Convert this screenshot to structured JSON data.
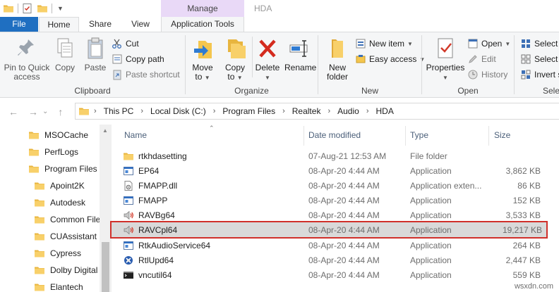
{
  "titlebar": {
    "context_tab": "Manage",
    "window_title": "HDA",
    "qat_icons": [
      "folder-icon",
      "properties-icon",
      "new-folder-icon",
      "customize-qat-icon"
    ]
  },
  "tabs": {
    "file": "File",
    "home": "Home",
    "share": "Share",
    "view": "View",
    "app_tools": "Application Tools"
  },
  "ribbon": {
    "clipboard": {
      "label": "Clipboard",
      "pin_line1": "Pin to Quick",
      "pin_line2": "access",
      "copy": "Copy",
      "paste": "Paste",
      "cut": "Cut",
      "copy_path": "Copy path",
      "paste_shortcut": "Paste shortcut"
    },
    "organize": {
      "label": "Organize",
      "move_line1": "Move",
      "move_line2": "to",
      "copy_line1": "Copy",
      "copy_line2": "to",
      "delete": "Delete",
      "rename": "Rename"
    },
    "new": {
      "label": "New",
      "new_folder_line1": "New",
      "new_folder_line2": "folder",
      "new_item": "New item",
      "easy_access": "Easy access"
    },
    "open": {
      "label": "Open",
      "properties": "Properties",
      "open": "Open",
      "edit": "Edit",
      "history": "History"
    },
    "select": {
      "label": "Sele",
      "select_all": "Select a",
      "select_none": "Select n",
      "invert": "Invert s"
    }
  },
  "address": {
    "crumbs": [
      "This PC",
      "Local Disk (C:)",
      "Program Files",
      "Realtek",
      "Audio",
      "HDA"
    ]
  },
  "nav_pane": {
    "items": [
      {
        "label": "MSOCache"
      },
      {
        "label": "PerfLogs"
      },
      {
        "label": "Program Files"
      },
      {
        "label": "Apoint2K"
      },
      {
        "label": "Autodesk"
      },
      {
        "label": "Common File"
      },
      {
        "label": "CUAssistant"
      },
      {
        "label": "Cypress"
      },
      {
        "label": "Dolby Digital"
      },
      {
        "label": "Elantech"
      }
    ]
  },
  "columns": {
    "name": "Name",
    "date": "Date modified",
    "type": "Type",
    "size": "Size"
  },
  "files": [
    {
      "name": "rtkhdasetting",
      "date": "07-Aug-21 12:53 AM",
      "type": "File folder",
      "size": "",
      "icon": "folder-icon"
    },
    {
      "name": "EP64",
      "date": "08-Apr-20 4:44 AM",
      "type": "Application",
      "size": "3,862 KB",
      "icon": "app-window-icon"
    },
    {
      "name": "FMAPP.dll",
      "date": "08-Apr-20 4:44 AM",
      "type": "Application exten...",
      "size": "86 KB",
      "icon": "dll-gear-icon"
    },
    {
      "name": "FMAPP",
      "date": "08-Apr-20 4:44 AM",
      "type": "Application",
      "size": "152 KB",
      "icon": "app-window-icon"
    },
    {
      "name": "RAVBg64",
      "date": "08-Apr-20 4:44 AM",
      "type": "Application",
      "size": "3,533 KB",
      "icon": "speaker-icon"
    },
    {
      "name": "RAVCpl64",
      "date": "08-Apr-20 4:44 AM",
      "type": "Application",
      "size": "19,217 KB",
      "icon": "speaker-icon",
      "selected": true
    },
    {
      "name": "RtkAudioService64",
      "date": "08-Apr-20 4:44 AM",
      "type": "Application",
      "size": "264 KB",
      "icon": "app-window-icon"
    },
    {
      "name": "RtlUpd64",
      "date": "08-Apr-20 4:44 AM",
      "type": "Application",
      "size": "2,447 KB",
      "icon": "updater-icon"
    },
    {
      "name": "vncutil64",
      "date": "08-Apr-20 4:44 AM",
      "type": "Application",
      "size": "559 KB",
      "icon": "console-icon"
    }
  ],
  "watermark": "wsxdn.com",
  "colors": {
    "file_tab": "#1f6fc1",
    "manage_context": "#e9d9f7",
    "selection_outline": "#d0302a",
    "folder": "#f4c64e"
  }
}
